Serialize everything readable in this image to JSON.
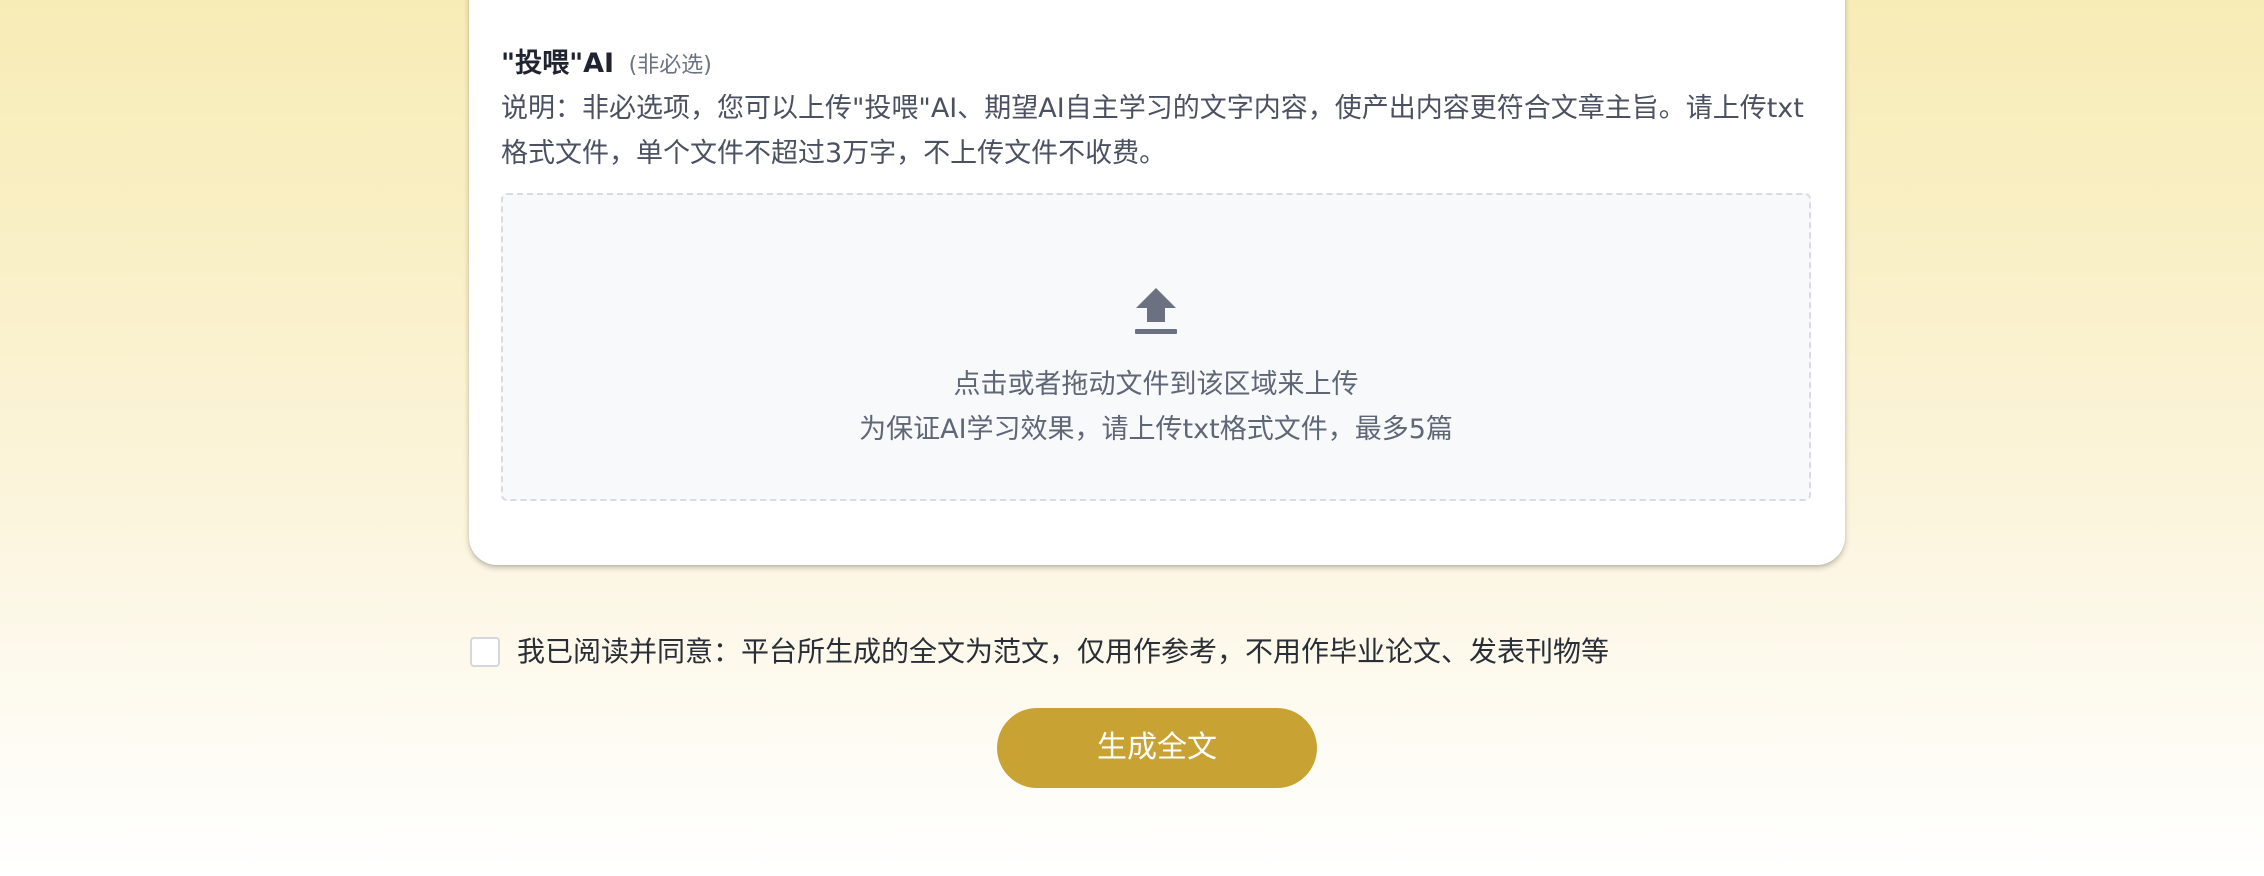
{
  "feed_ai": {
    "title": "\"投喂\"AI",
    "optional_tag": "(非必选)",
    "description": "说明：非必选项，您可以上传\"投喂\"AI、期望AI自主学习的文字内容，使产出内容更符合文章主旨。请上传txt格式文件，单个文件不超过3万字，不上传文件不收费。"
  },
  "upload": {
    "icon": "upload-icon",
    "hint_primary": "点击或者拖动文件到该区域来上传",
    "hint_secondary": "为保证AI学习效果，请上传txt格式文件，最多5篇"
  },
  "agreement": {
    "checked": false,
    "label": "我已阅读并同意：平台所生成的全文为范文，仅用作参考，不用作毕业论文、发表刊物等"
  },
  "actions": {
    "generate_label": "生成全文"
  },
  "colors": {
    "accent": "#c8a233",
    "background_top": "#f8ecb6",
    "background_bottom": "#ffffff"
  }
}
